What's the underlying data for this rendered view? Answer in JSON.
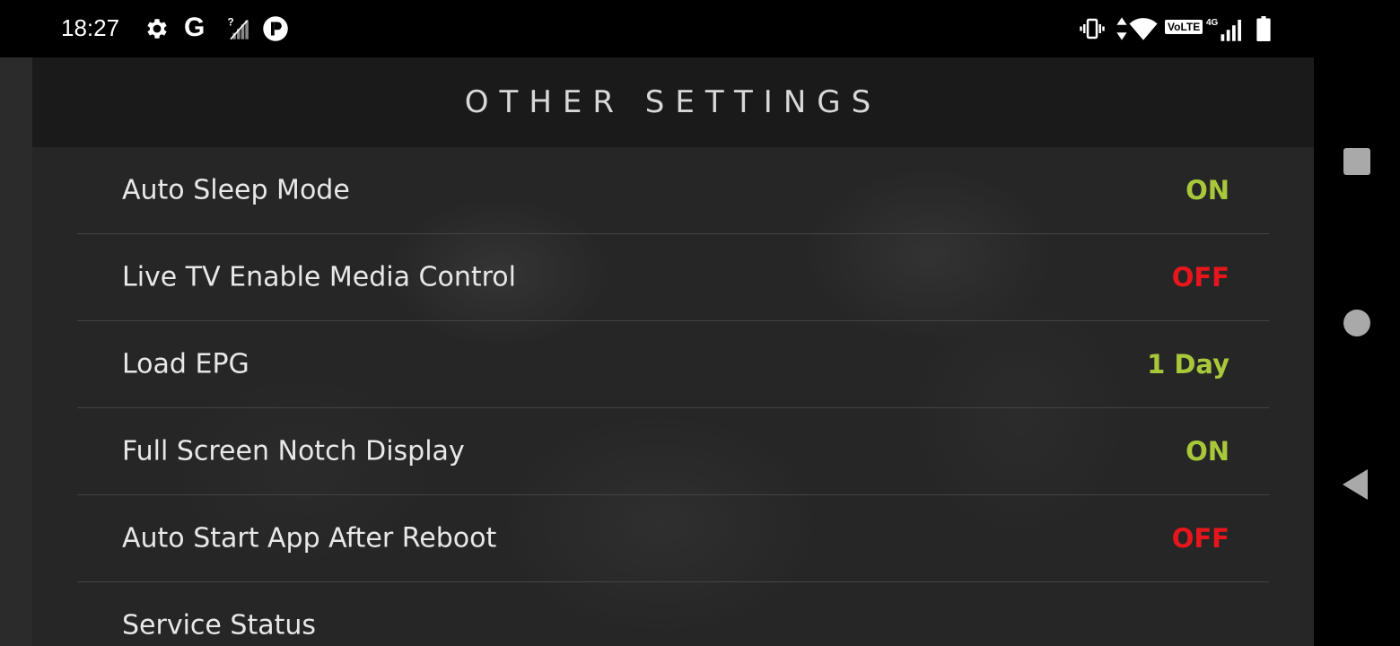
{
  "status_bar": {
    "time": "18:27",
    "google_label": "G",
    "volte_label": "VoLTE",
    "network_label": "4G",
    "icons": [
      "gear-icon",
      "google-icon",
      "no-signal-icon",
      "circle-p-icon",
      "vibrate-icon",
      "data-arrows-icon",
      "wifi-icon",
      "volte-icon",
      "signal-icon",
      "battery-icon"
    ]
  },
  "header": {
    "title": "OTHER SETTINGS"
  },
  "settings": [
    {
      "label": "Auto Sleep Mode",
      "value": "ON",
      "color": "#a8c83a"
    },
    {
      "label": "Live TV Enable Media Control",
      "value": "OFF",
      "color": "#e8161c"
    },
    {
      "label": "Load EPG",
      "value": "1 Day",
      "color": "#a8c83a"
    },
    {
      "label": "Full Screen Notch Display",
      "value": "ON",
      "color": "#a8c83a"
    },
    {
      "label": "Auto Start App After Reboot",
      "value": "OFF",
      "color": "#e8161c"
    },
    {
      "label": "Service Status",
      "value": "",
      "color": "#a8c83a"
    }
  ],
  "nav_bar": {
    "icons": [
      "recents-square-icon",
      "home-circle-icon",
      "back-triangle-icon"
    ]
  },
  "colors": {
    "on": "#a8c83a",
    "off": "#e8161c",
    "background": "#1f1f1f"
  }
}
